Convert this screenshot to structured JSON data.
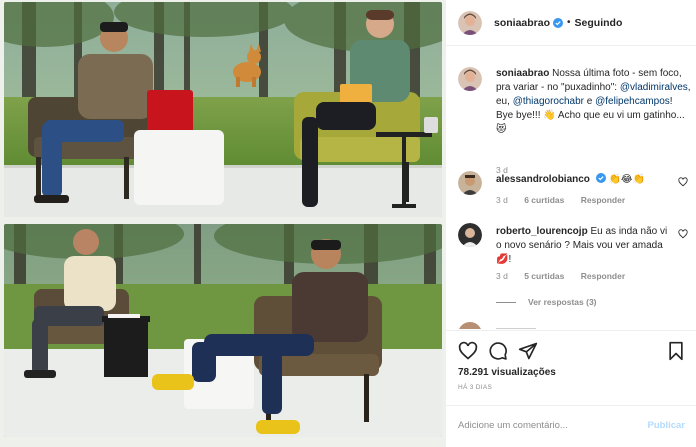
{
  "post": {
    "username": "soniaabrao",
    "follow_state": "Seguindo",
    "separator": "•"
  },
  "caption": {
    "username": "soniaabrao",
    "part1": "Nossa última foto - sem foco, pra variar - no \"puxadinho\":",
    "mention1": "@vladimiralves",
    "part2": ", eu,",
    "mention2": "@thiagorochabr",
    "part3": " e",
    "mention3": "@felipehcampos",
    "part4": "! Bye bye!!! 👋 Acho que eu vi um gatinho...😻",
    "time": "3 d"
  },
  "comments": [
    {
      "username": "alessandrolobianco",
      "text": "👏😂👏",
      "time": "3 d",
      "likes": "6 curtidas",
      "reply": "Responder"
    },
    {
      "username": "roberto_lourencojp",
      "text": "Eu as inda não vi o novo senário ? Mais vou ver amada 💋!",
      "time": "3 d",
      "likes": "5 curtidas",
      "reply": "Responder",
      "view_replies": "Ver respostas (3)"
    }
  ],
  "stats": {
    "views": "78.291 visualizações",
    "time_ago": "HÁ 3 DIAS"
  },
  "add_comment": {
    "placeholder": "Adicione um comentário...",
    "publish": "Publicar"
  },
  "icons": {
    "like": "heart-icon",
    "comment": "comment-icon",
    "share": "paper-plane-icon",
    "save": "bookmark-icon",
    "verified": "verified-badge-icon"
  },
  "colors": {
    "verified": "#3897f0",
    "mention": "#00376b",
    "muted": "#8e8e8e",
    "publish": "#b3dbff"
  }
}
